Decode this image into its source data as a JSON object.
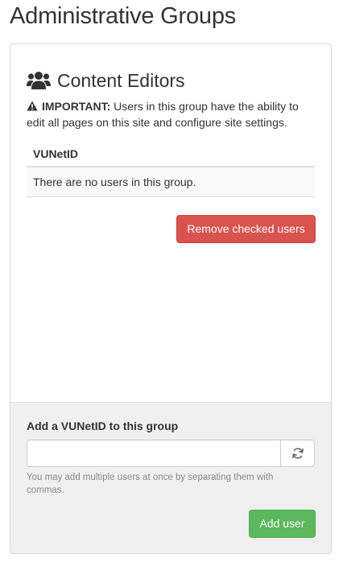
{
  "page": {
    "title": "Administrative Groups"
  },
  "group": {
    "name": "Content Editors",
    "icon": "users-icon",
    "notice": {
      "icon": "warning-icon",
      "label": "IMPORTANT:",
      "text": " Users in this group have the ability to edit all pages on this site and configure site settings."
    },
    "table": {
      "header": "VUNetID",
      "empty_message": "There are no users in this group."
    },
    "remove_button_label": "Remove checked users"
  },
  "footer": {
    "add_label": "Add a VUNetID to this group",
    "input_value": "",
    "input_placeholder": "",
    "refresh_icon": "refresh-icon",
    "help_text": "You may add multiple users at once by separating them with commas.",
    "add_button_label": "Add user"
  },
  "colors": {
    "danger": "#d9534f",
    "success": "#5cb85c",
    "footer_bg": "#f0f0f0"
  }
}
